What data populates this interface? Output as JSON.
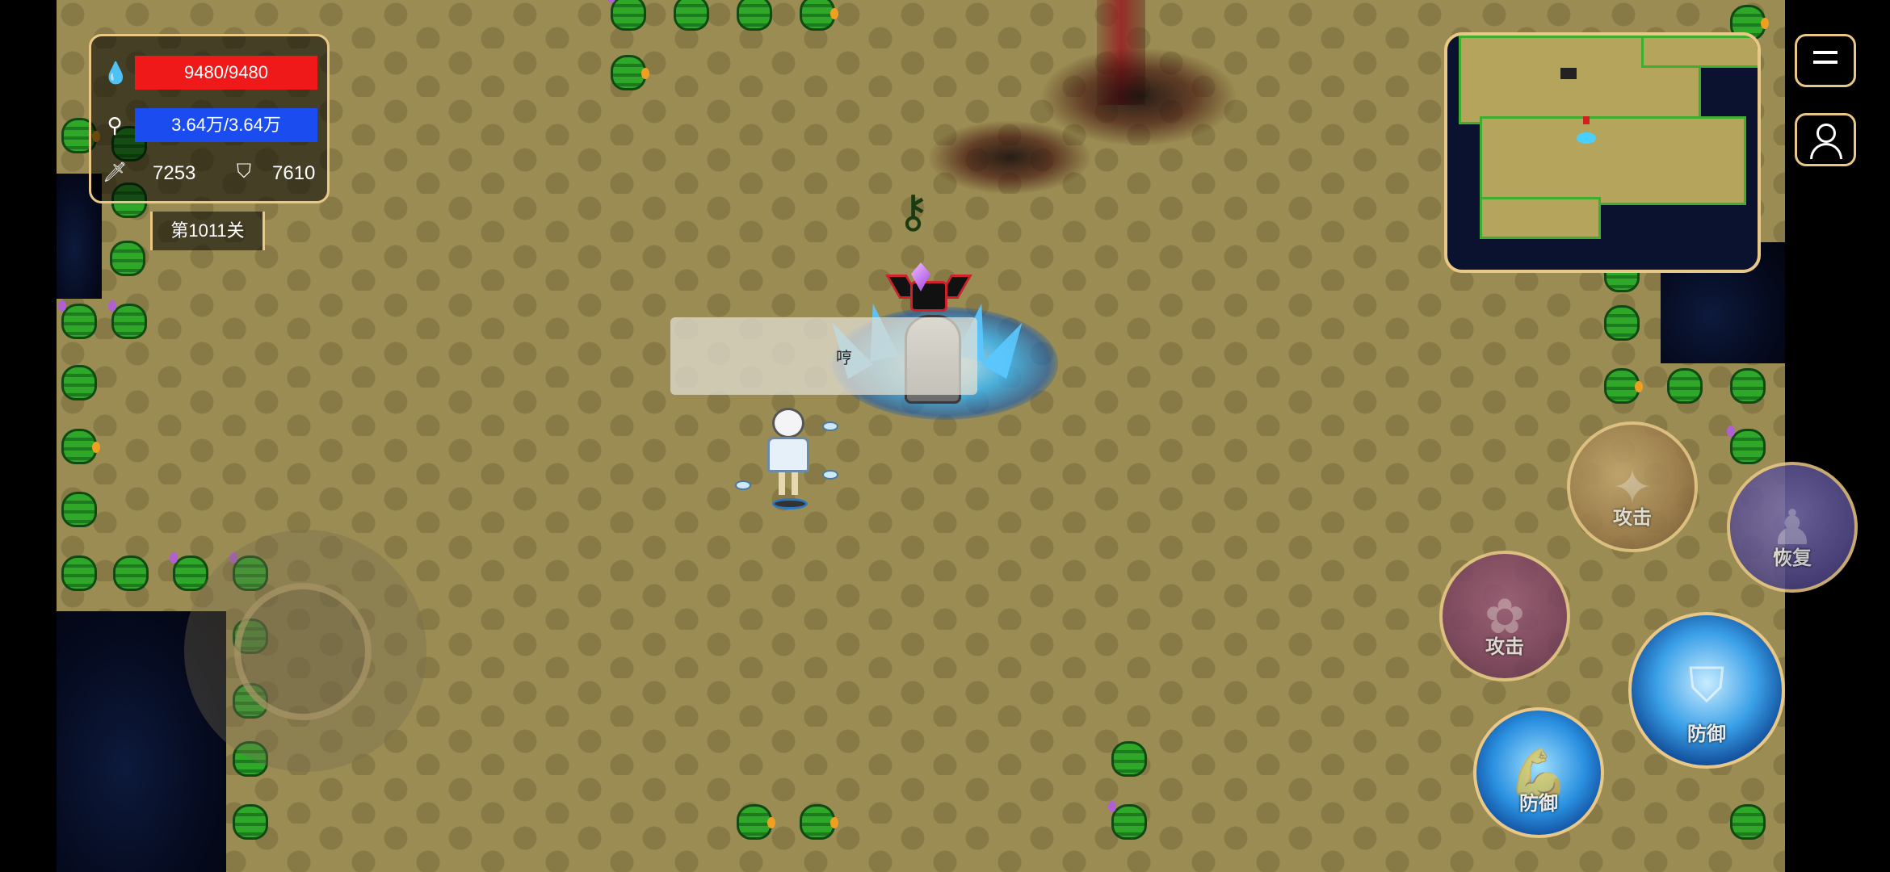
{
  "hud": {
    "hp_text": "9480/9480",
    "mp_text": "3.64万/3.64万",
    "attack": "7253",
    "defense": "7610",
    "level": "第1011关",
    "hp_color": "#f0191a",
    "mp_color": "#1a4cf0"
  },
  "speech": {
    "text": "哼"
  },
  "skills": {
    "attack_top": "攻击",
    "recover": "恢复",
    "attack_left": "攻击",
    "defend_right": "防御",
    "defend_bottom": "防御"
  },
  "icons": {
    "hp": "blood-drop-icon",
    "mp": "mana-icon",
    "attack": "sword-icon",
    "defense": "shield-icon",
    "menu": "menu-icon",
    "profile": "profile-icon"
  },
  "colors": {
    "panel_border": "#e9c887",
    "ground": "#9a8c52"
  }
}
